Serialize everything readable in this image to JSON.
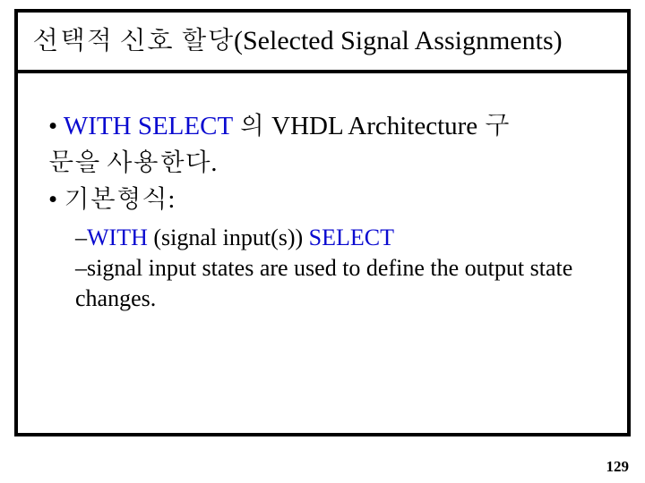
{
  "title": "선택적 신호 할당(Selected Signal Assignments)",
  "bullet1": {
    "prefix": "• ",
    "kw1": "WITH",
    "mid1": "  ",
    "kw2": "SELECT",
    "rest_line1": " 의 VHDL Architecture 구",
    "line2": "문을 사용한다."
  },
  "bullet2": "• 기본형식:",
  "sub1": {
    "prefix": "–",
    "kwW": "WITH",
    "paren": " (signal input(s)) ",
    "kwS": "SELECT"
  },
  "sub2": "–signal input states are used to define the output state changes.",
  "page_number": "129"
}
